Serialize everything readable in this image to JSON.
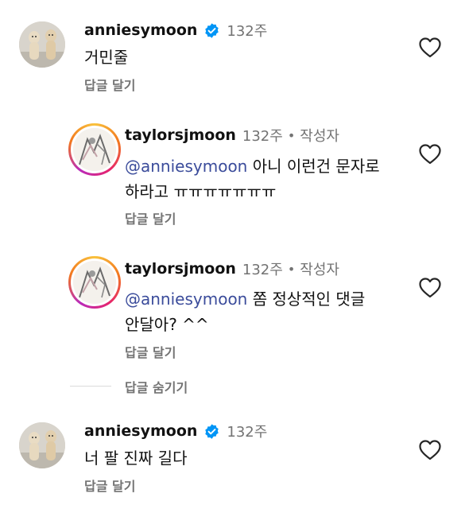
{
  "comments": [
    {
      "username": "anniesymoon",
      "time": "132주",
      "text": "거민줄",
      "reply_label": "답글 달기"
    },
    {
      "username": "taylorsjmoon",
      "time": "132주",
      "author_badge": "작성자",
      "mention": "@anniesymoon",
      "text_line1": " 아니 이런건 문자로",
      "text_line2": "하라고 ㅠㅠㅠㅠㅠㅠㅠ",
      "reply_label": "답글 달기"
    },
    {
      "username": "taylorsjmoon",
      "time": "132주",
      "author_badge": "작성자",
      "mention": "@anniesymoon",
      "text_line1": " 쫌 정상적인 댓글",
      "text_line2": "안달아? ^^",
      "reply_label": "답글 달기"
    },
    {
      "username": "anniesymoon",
      "time": "132주",
      "text": "너 팔 진짜 길다",
      "reply_label": "답글 달기"
    }
  ],
  "hide_replies_label": "답글 숨기기",
  "dot_separator": "•",
  "colors": {
    "verified_badge": "#0095f6",
    "mention": "#3b4c9b",
    "secondary_text": "#737373"
  },
  "icons": {
    "like": "heart-outline-icon",
    "verified": "verified-badge-icon"
  }
}
